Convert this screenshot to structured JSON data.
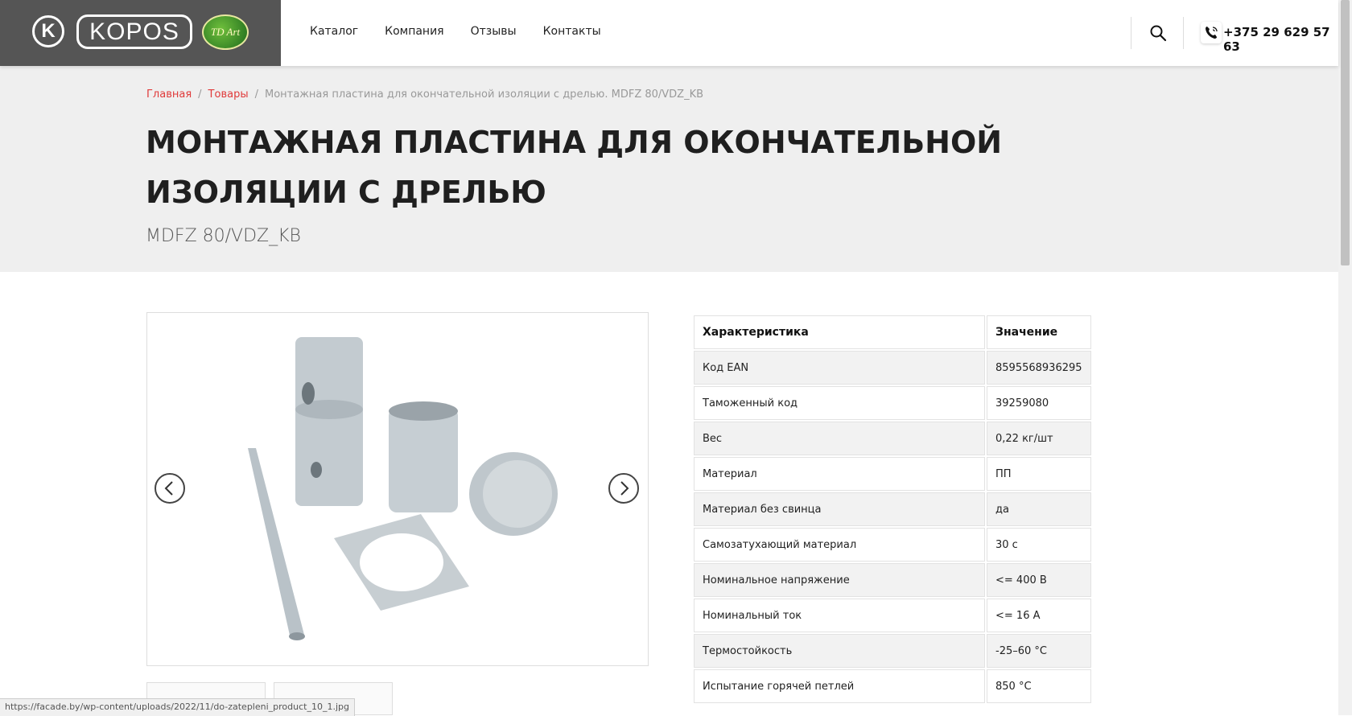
{
  "header": {
    "logo_k": "K",
    "logo_text": "KOPOS",
    "logo_badge": "TD Art",
    "nav": [
      "Каталог",
      "Компания",
      "Отзывы",
      "Контакты"
    ],
    "phone": "+375 29 629 57 63"
  },
  "breadcrumb": {
    "home": "Главная",
    "products": "Товары",
    "current": "Монтажная пластина для окончательной изоляции с дрелью. MDFZ 80/VDZ_KB"
  },
  "title": "Монтажная пластина для окончательной изоляции с дрелью",
  "subtitle": "MDFZ 80/VDZ_KB",
  "specs": {
    "header": [
      "Характеристика",
      "Значение"
    ],
    "rows": [
      [
        "Код EAN",
        "8595568936295"
      ],
      [
        "Таможенный код",
        "39259080"
      ],
      [
        "Вес",
        "0,22 кг/шт"
      ],
      [
        "Материал",
        "ПП"
      ],
      [
        "Материал без свинца",
        "да"
      ],
      [
        "Самозатухающий материал",
        "30 с"
      ],
      [
        "Номинальное напряжение",
        "<= 400 В"
      ],
      [
        "Номинальный ток",
        "<= 16 А"
      ],
      [
        "Термостойкость",
        "-25–60 °C"
      ],
      [
        "Испытание горячей петлей",
        "850 °C"
      ]
    ]
  },
  "status_url": "https://facade.by/wp-content/uploads/2022/11/do-zatepleni_product_10_1.jpg",
  "colors": {
    "accent": "#e03a3a",
    "logo_bg": "#555555",
    "band": "#efefef"
  }
}
